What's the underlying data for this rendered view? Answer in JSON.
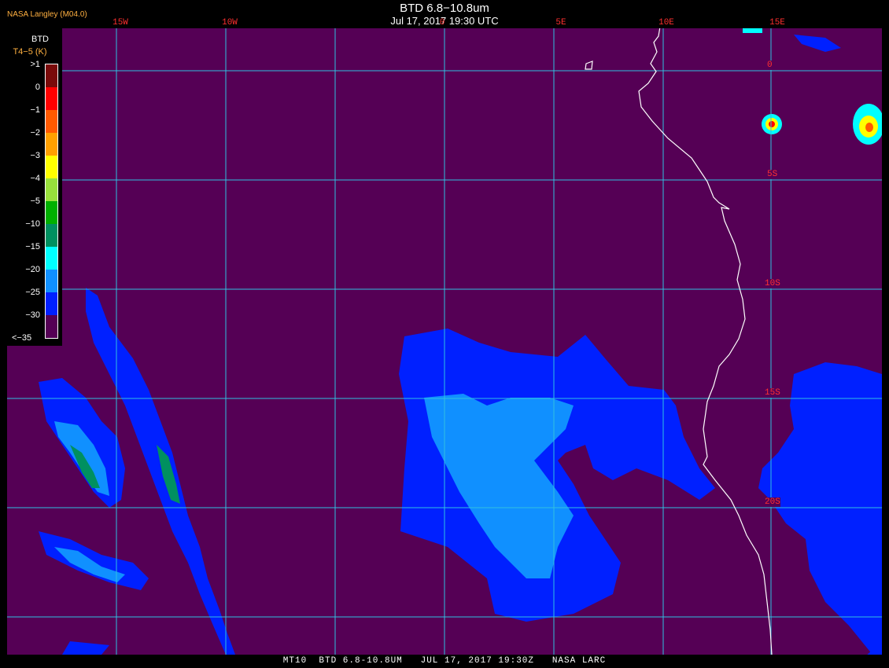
{
  "header": {
    "credit": "NASA Langley (M04.0)",
    "title": "BTD 6.8−10.8um",
    "subtitle": "Jul 17, 2017 19:30 UTC"
  },
  "legend": {
    "title": "BTD",
    "subtitle": "T4−5 (K)",
    "labels": [
      ">1",
      "0",
      "−1",
      "−2",
      "−3",
      "−4",
      "−5",
      "−10",
      "−15",
      "−20",
      "−25",
      "−30",
      "<−35"
    ],
    "colors": [
      "#7a0a0a",
      "#ff0000",
      "#ff5a00",
      "#ffa000",
      "#ffff00",
      "#98e03c",
      "#00b000",
      "#009060",
      "#00ffff",
      "#1090ff",
      "#0020ff",
      "#550055"
    ]
  },
  "grid": {
    "longitudes": [
      "15W",
      "10W",
      "0",
      "5E",
      "10E",
      "15E"
    ],
    "latitudes": [
      "0",
      "5S",
      "10S",
      "15S",
      "20S"
    ],
    "color": "#30c0e0"
  },
  "colors": {
    "background": "#550055",
    "coastline": "#ffffff",
    "label": "#ff3030"
  },
  "footer": {
    "text": "MT10  BTD 6.8-10.8UM   JUL 17, 2017 19:30Z   NASA LARC"
  }
}
